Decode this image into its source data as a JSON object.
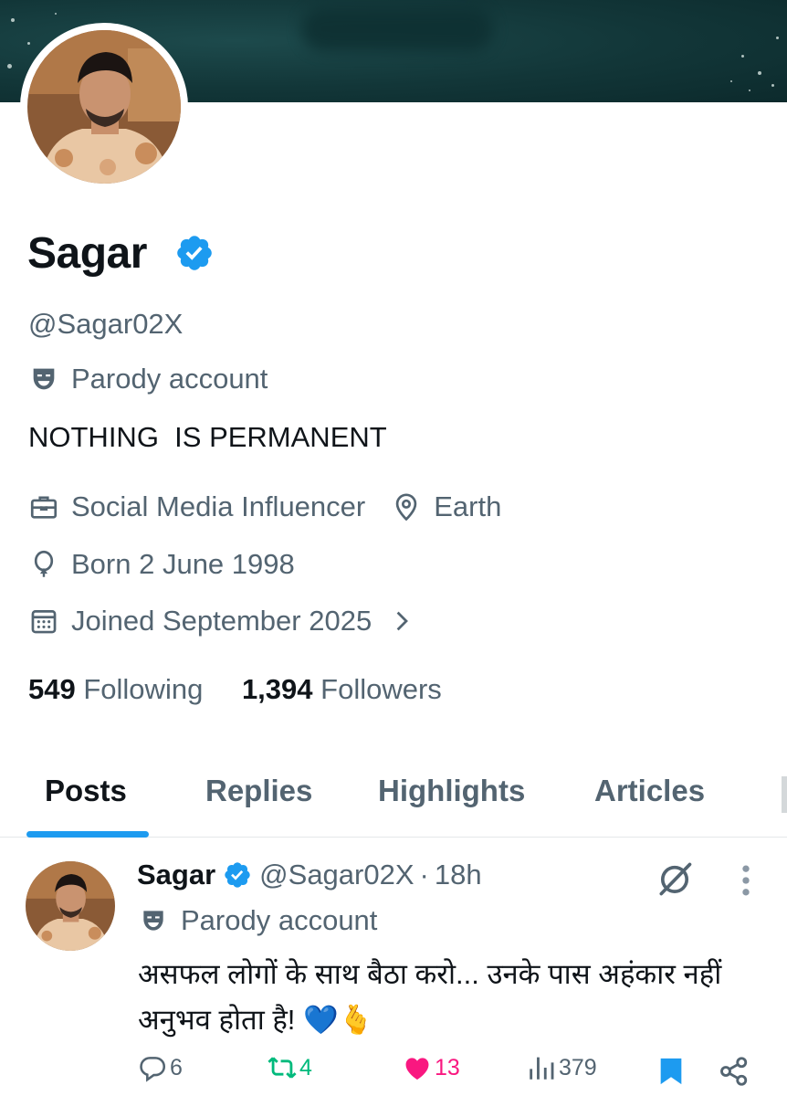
{
  "profile": {
    "name": "Sagar",
    "handle": "@Sagar02X",
    "parody_label": "Parody account",
    "bio": "NOTHING  IS PERMANENT",
    "profession": "Social Media Influencer",
    "location": "Earth",
    "birthday": "Born 2 June 1998",
    "joined": "Joined September 2025",
    "following_count": "549",
    "following_label": "Following",
    "followers_count": "1,394",
    "followers_label": "Followers"
  },
  "tabs": [
    {
      "label": "Posts",
      "active": true
    },
    {
      "label": "Replies",
      "active": false
    },
    {
      "label": "Highlights",
      "active": false
    },
    {
      "label": "Articles",
      "active": false
    }
  ],
  "post": {
    "author": "Sagar",
    "handle": "@Sagar02X",
    "separator": "·",
    "time": "18h",
    "parody_label": "Parody account",
    "text": "असफल लोगों के साथ बैठा करो... उनके पास अहंकार नहीं अनुभव होता है! 💙🫰",
    "replies": "6",
    "reposts": "4",
    "likes": "13",
    "views": "379"
  },
  "icons": {
    "verified": "verified-badge-icon",
    "parody": "theater-mask-icon",
    "profession": "briefcase-icon",
    "location": "location-pin-icon",
    "birthday": "balloon-icon",
    "joined": "calendar-icon",
    "chevron": "chevron-right-icon",
    "grok": "grok-icon",
    "more": "more-vertical-icon",
    "reply": "reply-icon",
    "repost": "repost-icon",
    "like": "heart-icon",
    "views": "views-icon",
    "bookmark": "bookmark-icon",
    "share": "share-icon"
  },
  "colors": {
    "accent": "#1d9bf0",
    "text_primary": "#0f1419",
    "text_secondary": "#536471",
    "repost_green": "#00ba7c",
    "like_pink": "#f91880",
    "banner": "#123638"
  }
}
